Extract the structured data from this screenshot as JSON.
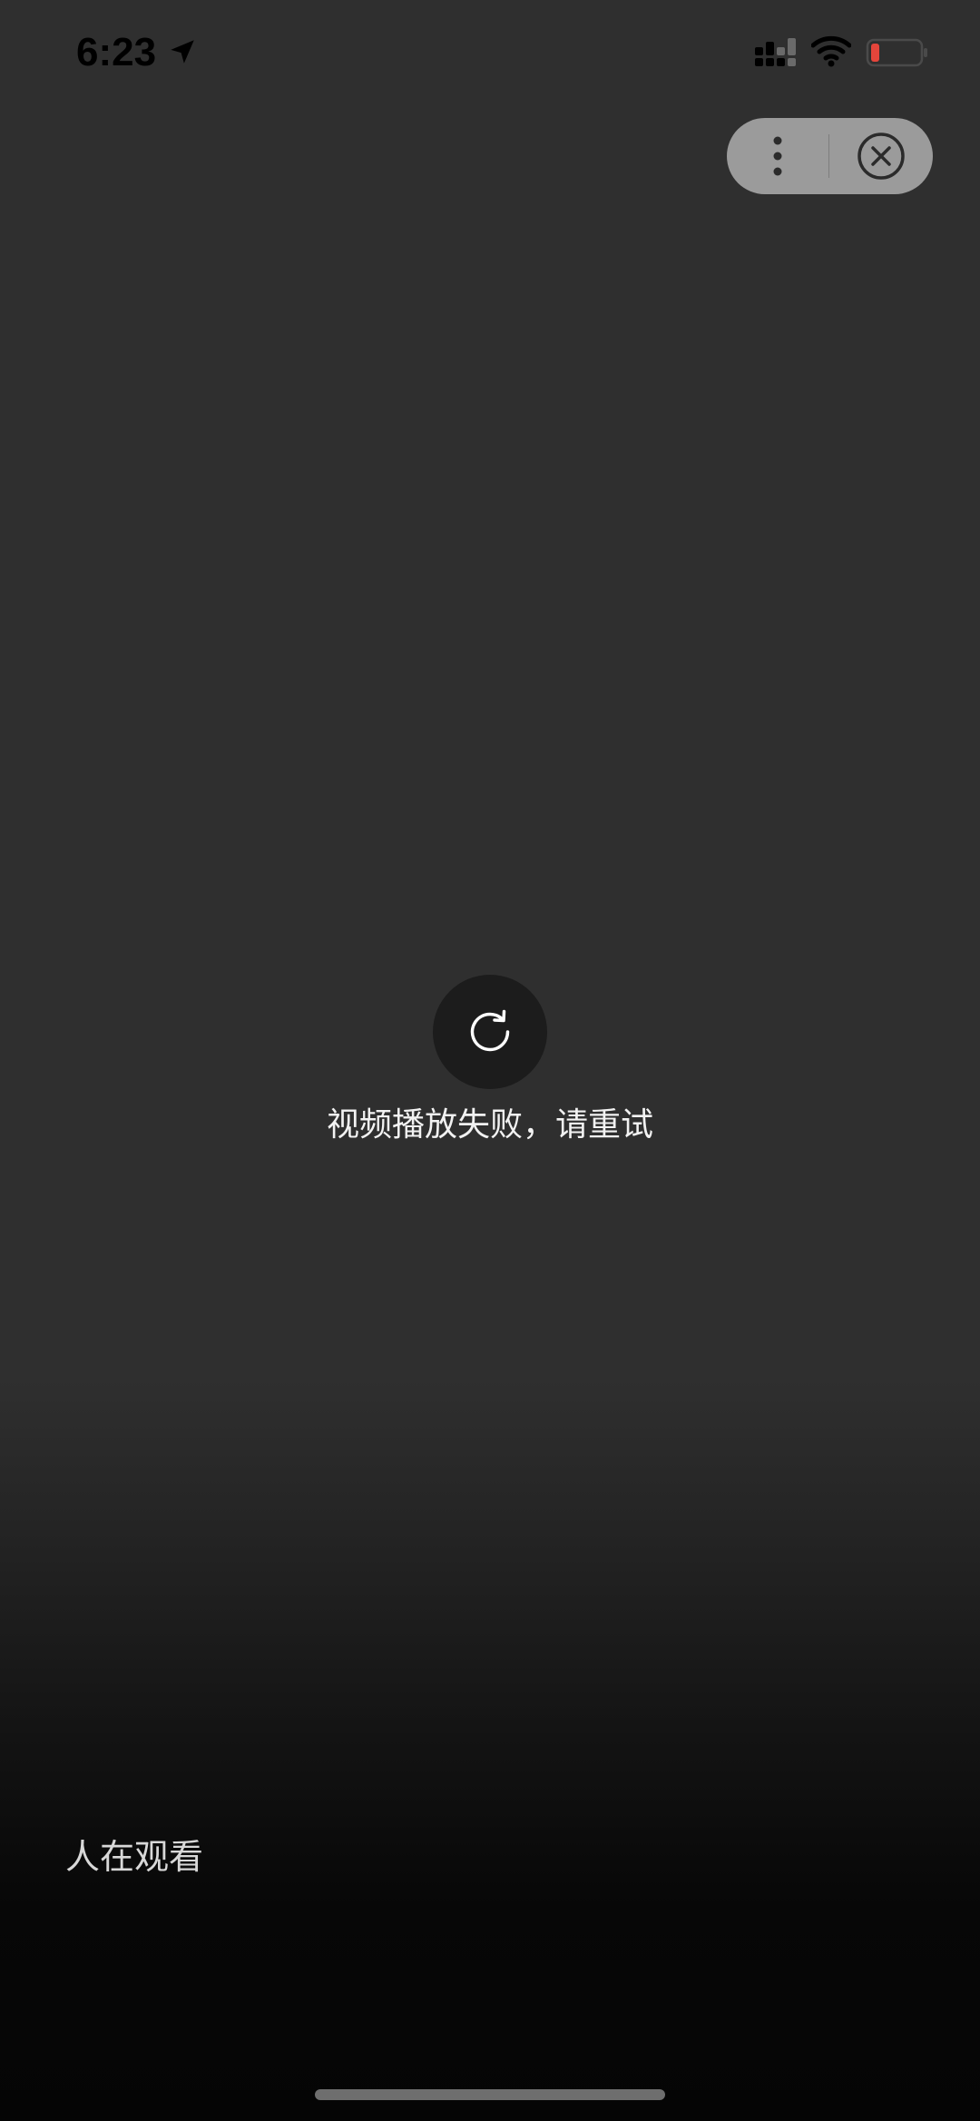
{
  "status_bar": {
    "time": "6:23",
    "icons": [
      "location-arrow-icon",
      "cellular-signal-icon",
      "wifi-icon",
      "battery-icon"
    ],
    "battery_color": "#e5453b"
  },
  "capsule": {
    "icons": [
      "more-dots-icon",
      "close-circle-icon"
    ]
  },
  "player": {
    "retry_icon": "refresh-icon",
    "error_message": "视频播放失败，请重试",
    "viewers_label": "人在观看"
  },
  "colors": {
    "background_top": "#2f2f2f",
    "background_bottom": "#050505",
    "capsule_bg": "#9b9b9b",
    "retry_bg": "#1c1c1c"
  }
}
